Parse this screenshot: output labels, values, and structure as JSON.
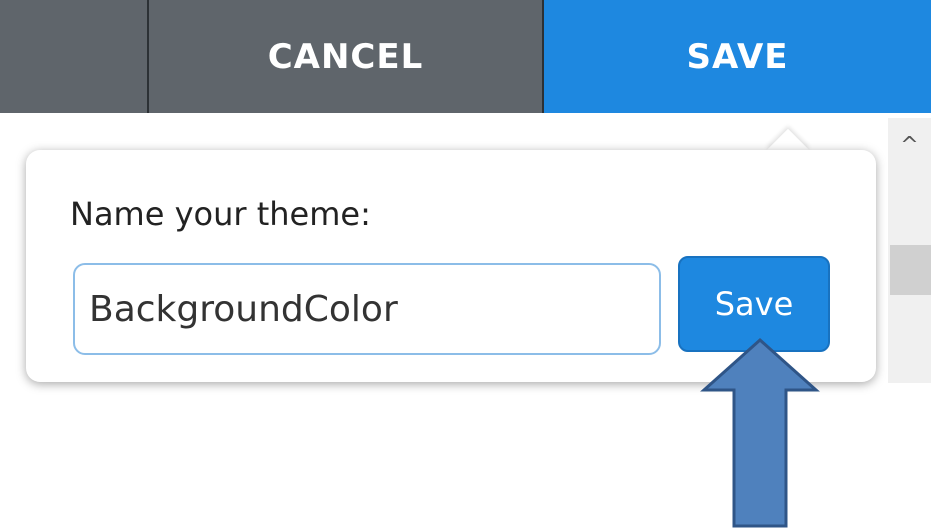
{
  "toolbar": {
    "cancel_label": "CANCEL",
    "save_label": "SAVE"
  },
  "popover": {
    "label": "Name your theme:",
    "input_value": "BackgroundColor",
    "save_label": "Save"
  },
  "scrollbar": {
    "up_icon": "^"
  },
  "colors": {
    "toolbar_bg": "#5f656b",
    "accent": "#1e88e0",
    "arrow_fill": "#4f81bd",
    "arrow_stroke": "#2f5587"
  }
}
